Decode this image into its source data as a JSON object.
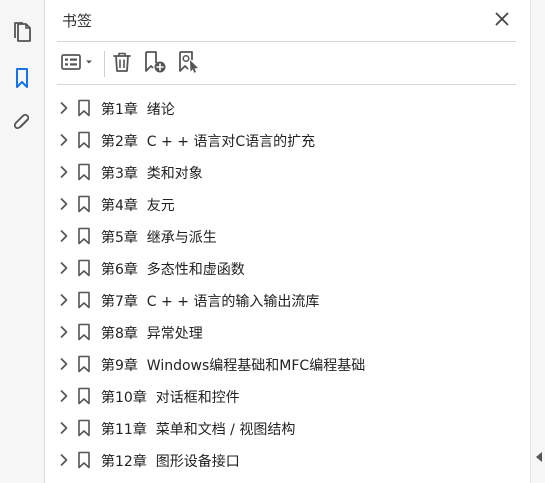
{
  "panel": {
    "title": "书签"
  },
  "rail": {
    "items": [
      {
        "icon": "pages-icon"
      },
      {
        "icon": "bookmark-icon",
        "active": true
      },
      {
        "icon": "attachment-icon"
      }
    ]
  },
  "toolbar": {
    "items": [
      "options-menu-icon",
      "delete-icon",
      "new-bookmark-icon",
      "bookmark-from-selection-icon"
    ]
  },
  "colors": {
    "accent": "#1473e6",
    "icon": "#555555",
    "divider": "#d6d6d6"
  },
  "bookmarks": [
    {
      "label": "第1章  绪论"
    },
    {
      "label": "第2章  C + + 语言对C语言的扩充"
    },
    {
      "label": "第3章  类和对象"
    },
    {
      "label": "第4章  友元"
    },
    {
      "label": "第5章  继承与派生"
    },
    {
      "label": "第6章  多态性和虚函数"
    },
    {
      "label": "第7章  C + + 语言的输入输出流库"
    },
    {
      "label": "第8章  异常处理"
    },
    {
      "label": "第9章  Windows编程基础和MFC编程基础"
    },
    {
      "label": "第10章  对话框和控件"
    },
    {
      "label": "第11章  菜单和文档 / 视图结构"
    },
    {
      "label": "第12章  图形设备接口"
    }
  ]
}
